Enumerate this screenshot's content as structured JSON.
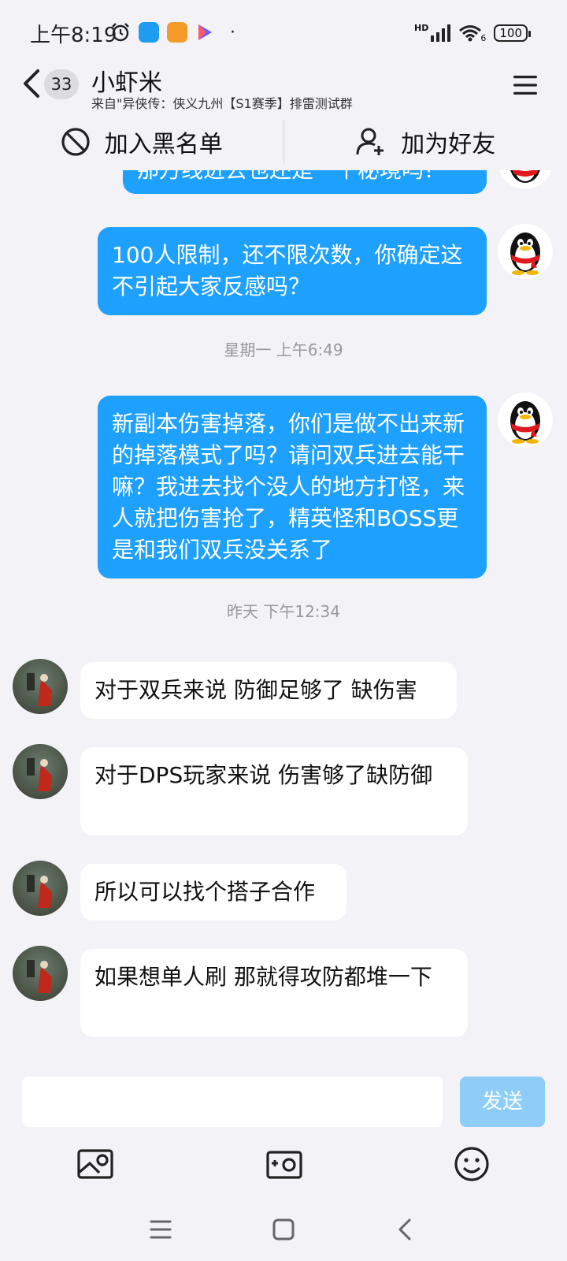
{
  "status": {
    "time": "上午8:19",
    "battery": "100",
    "hd": "HD",
    "wifi_sub": "6",
    "dot": "·"
  },
  "header": {
    "unread": "33",
    "title": "小虾米",
    "subtitle": "来自\"异侠传：侠义九州【S1赛季】排雷测试群"
  },
  "actions": {
    "blacklist": "加入黑名单",
    "add_friend": "加为好友"
  },
  "messages": {
    "m0": "那万线进去也还是一个秘境吗？",
    "m1": "100人限制，还不限次数，你确定这不引起大家反感吗？",
    "t1": "星期一 上午6:49",
    "m2": "新副本伤害掉落，你们是做不出来新的掉落模式了吗？请问双兵进去能干嘛？我进去找个没人的地方打怪，来人就把伤害抢了，精英怪和BOSS更是和我们双兵没关系了",
    "t2": "昨天 下午12:34",
    "m3": "对于双兵来说 防御足够了 缺伤害",
    "m4": "对于DPS玩家来说 伤害够了缺防御",
    "m5": "所以可以找个搭子合作",
    "m6": "如果想单人刷 那就得攻防都堆一下"
  },
  "input": {
    "send_label": "发送",
    "value": ""
  },
  "colors": {
    "bubble_out": "#1ea0ff",
    "send_disabled": "#8dcdf7",
    "background": "#f2f2f7"
  }
}
